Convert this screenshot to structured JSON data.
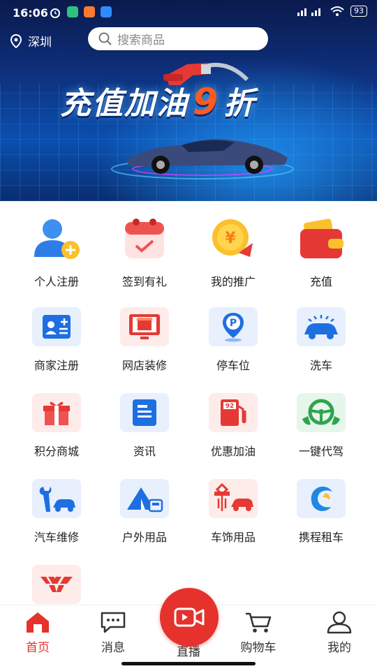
{
  "status_bar": {
    "time": "16:06",
    "battery": "93"
  },
  "header": {
    "location": "深圳",
    "search_placeholder": "搜索商品"
  },
  "banner": {
    "title_prefix": "充值加油",
    "title_highlight": "9",
    "title_suffix": "折"
  },
  "services": [
    {
      "label": "个人注册",
      "icon": "user-add-icon"
    },
    {
      "label": "签到有礼",
      "icon": "calendar-check-icon"
    },
    {
      "label": "我的推广",
      "icon": "coin-arrow-icon"
    },
    {
      "label": "充值",
      "icon": "wallet-icon"
    },
    {
      "label": "商家注册",
      "icon": "merchant-card-icon"
    },
    {
      "label": "网店装修",
      "icon": "shop-monitor-icon"
    },
    {
      "label": "停车位",
      "icon": "parking-pin-icon"
    },
    {
      "label": "洗车",
      "icon": "car-wash-icon"
    },
    {
      "label": "积分商城",
      "icon": "gift-icon"
    },
    {
      "label": "资讯",
      "icon": "news-icon"
    },
    {
      "label": "优惠加油",
      "icon": "fuel-pump-icon"
    },
    {
      "label": "一键代驾",
      "icon": "steering-wheel-icon"
    },
    {
      "label": "汽车维修",
      "icon": "wrench-car-icon"
    },
    {
      "label": "户外用品",
      "icon": "tent-icon"
    },
    {
      "label": "车饰用品",
      "icon": "knot-car-icon"
    },
    {
      "label": "携程租车",
      "icon": "ctrip-dolphin-icon"
    },
    {
      "label": "",
      "icon": "wuling-logo-icon"
    }
  ],
  "tabbar": {
    "home": "首页",
    "messages": "消息",
    "live": "直播",
    "cart": "购物车",
    "mine": "我的"
  },
  "colors": {
    "accent": "#e5322d",
    "banner_blue": "#0e2f7a"
  }
}
